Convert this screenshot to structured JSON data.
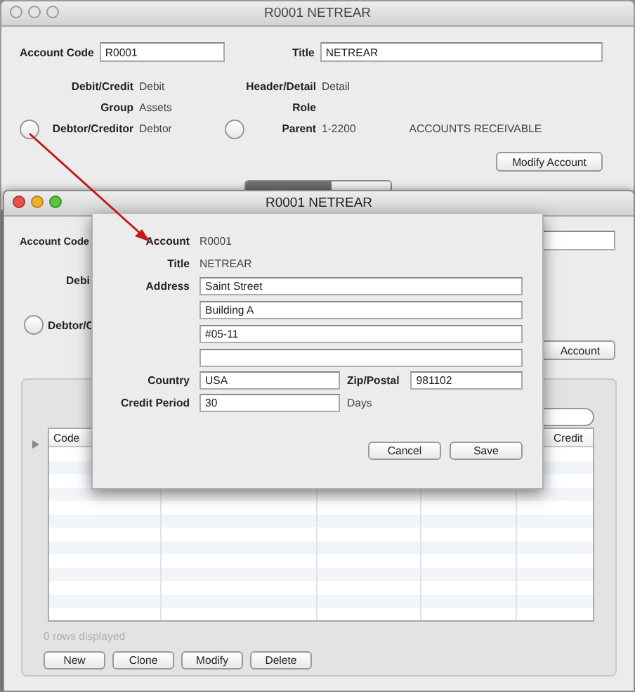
{
  "back_window": {
    "title": "R0001 NETREAR",
    "fields": [
      {
        "label": "Account Code",
        "value": "R0001"
      },
      {
        "label": "Title",
        "value": "NETREAR"
      }
    ],
    "details": [
      {
        "kind": "text",
        "label": "Debit/Credit",
        "value": "Debit"
      },
      {
        "kind": "text",
        "label": "Header/Detail",
        "value": "Detail"
      },
      {
        "kind": "text",
        "label": "Group",
        "value": "Assets"
      },
      {
        "kind": "text",
        "label": "Role"
      },
      {
        "kind": "radio",
        "label": "Debtor/Creditor",
        "value": "Debtor",
        "selected": false
      },
      {
        "kind": "radio",
        "label": "Parent",
        "value": "1-2200",
        "extra": "ACCOUNTS RECEIVABLE",
        "selected": false
      }
    ],
    "modify_button": "Modify Account"
  },
  "front_window": {
    "title": "R0001 NETREAR",
    "account_code_label": "Account Code",
    "debit_label": "Debi",
    "debtor_radio": {
      "label": "Debtor/C",
      "selected": false
    },
    "modify_button": "Account",
    "table": {
      "columns": [
        {
          "label": "Code"
        },
        {
          "label": "Credit"
        }
      ]
    },
    "status": "0 rows displayed",
    "buttons": [
      "New",
      "Clone",
      "Modify",
      "Delete"
    ]
  },
  "sheet": {
    "account": {
      "label": "Account",
      "value": "R0001"
    },
    "title": {
      "label": "Title",
      "value": "NETREAR"
    },
    "address": {
      "label": "Address",
      "lines": [
        "Saint Street",
        "Building A",
        "#05-11"
      ]
    },
    "country": {
      "label": "Country",
      "value": "USA"
    },
    "zip": {
      "label": "Zip/Postal",
      "value": "981102"
    },
    "credit_period": {
      "label": "Credit Period",
      "value": "30",
      "unit": "Days"
    },
    "buttons": [
      "Cancel",
      "Save"
    ]
  }
}
